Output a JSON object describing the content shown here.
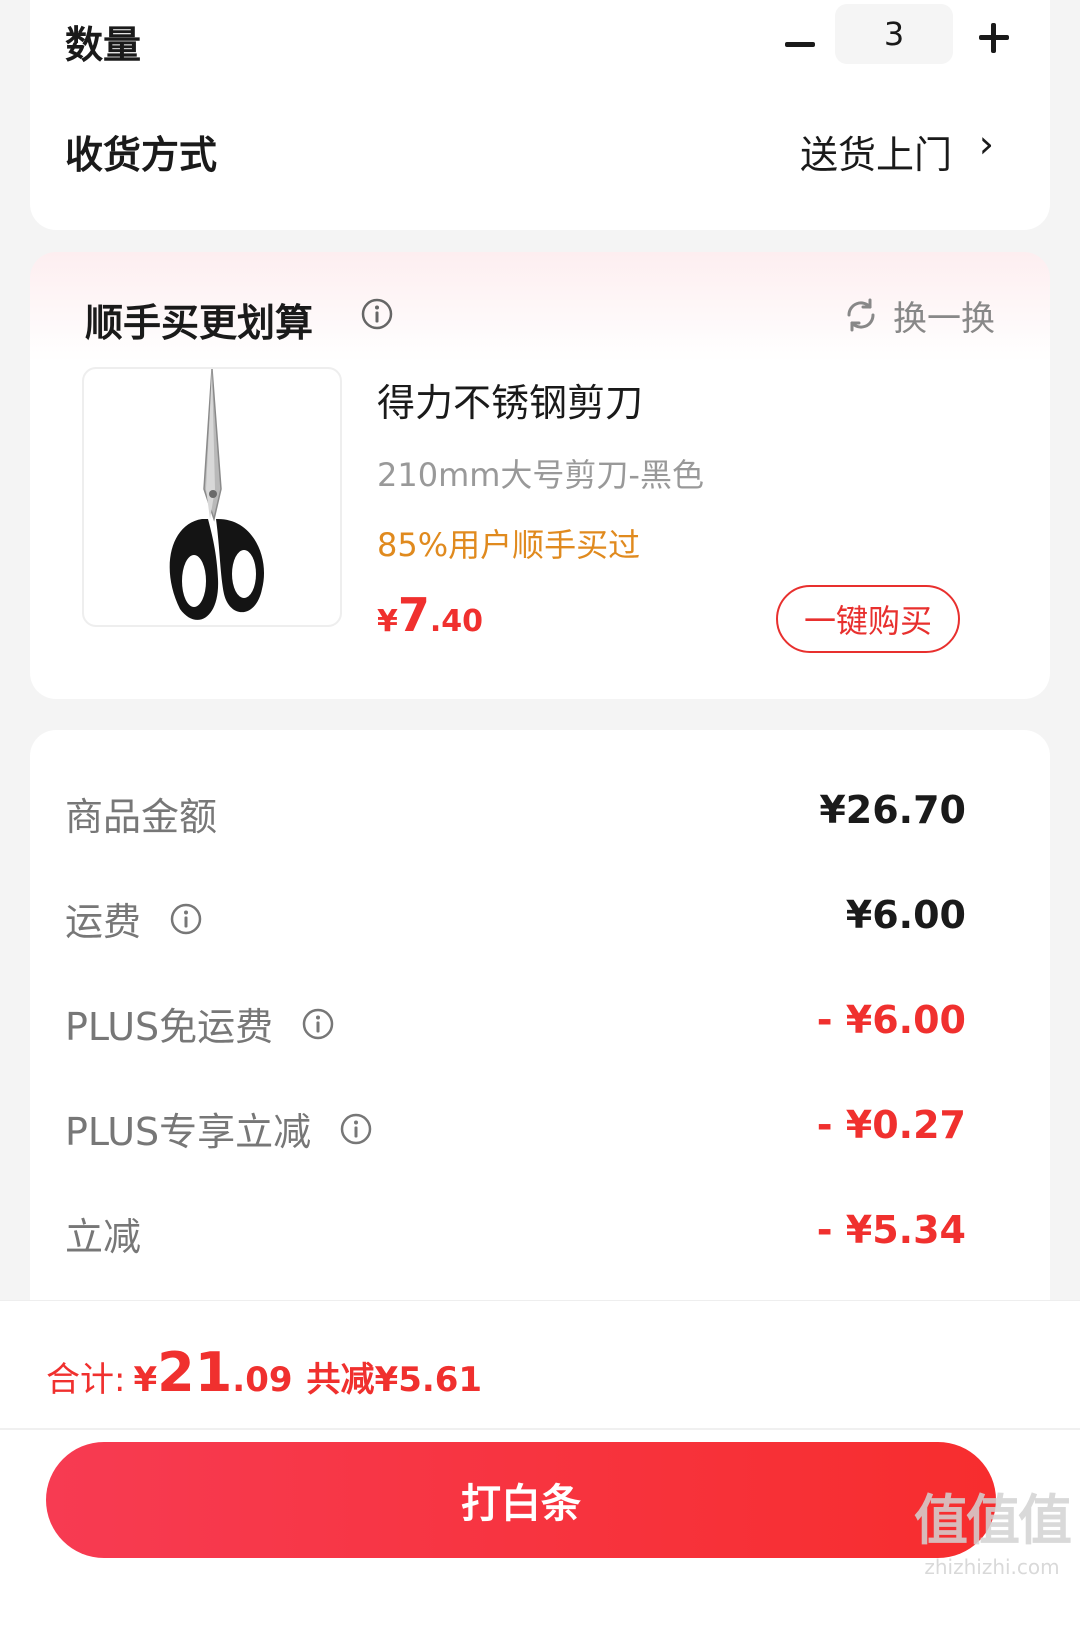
{
  "order": {
    "quantity_label": "数量",
    "quantity_value": "3",
    "delivery_label": "收货方式",
    "delivery_value": "送货上门"
  },
  "recommendation": {
    "title": "顺手买更划算",
    "refresh_label": "换一换",
    "product": {
      "name": "得力不锈钢剪刀",
      "spec": "210mm大号剪刀-黑色",
      "promo": "85%用户顺手买过",
      "price_currency": "¥",
      "price_int": "7",
      "price_dec": ".40",
      "buy_label": "一键购买"
    }
  },
  "breakdown": {
    "items": [
      {
        "label": "商品金额",
        "value": "¥26.70",
        "info": false,
        "highlight": false
      },
      {
        "label": "运费",
        "value": "¥6.00",
        "info": true,
        "highlight": false
      },
      {
        "label": "PLUS免运费",
        "value": "- ¥6.00",
        "info": true,
        "highlight": true
      },
      {
        "label": "PLUS专享立减",
        "value": "- ¥0.27",
        "info": true,
        "highlight": true
      },
      {
        "label": "立减",
        "value": "- ¥5.34",
        "info": false,
        "highlight": true
      }
    ]
  },
  "footer": {
    "total_label": "合计:",
    "total_currency": "¥",
    "total_int": "21",
    "total_dec": ".09",
    "total_saved": "共减¥5.61",
    "pay_button_label": "打白条"
  },
  "watermark": {
    "logo": "值值值",
    "site": "zhizhizhi.com"
  },
  "colors": {
    "accent_red": "#f0302e",
    "promo_orange": "#e08a1e",
    "button_gradient_start": "#f73b52",
    "button_gradient_end": "#f72d2e"
  },
  "icons": [
    "minus-icon",
    "plus-icon",
    "chevron-right-icon",
    "info-icon",
    "refresh-icon",
    "scissors-image"
  ]
}
